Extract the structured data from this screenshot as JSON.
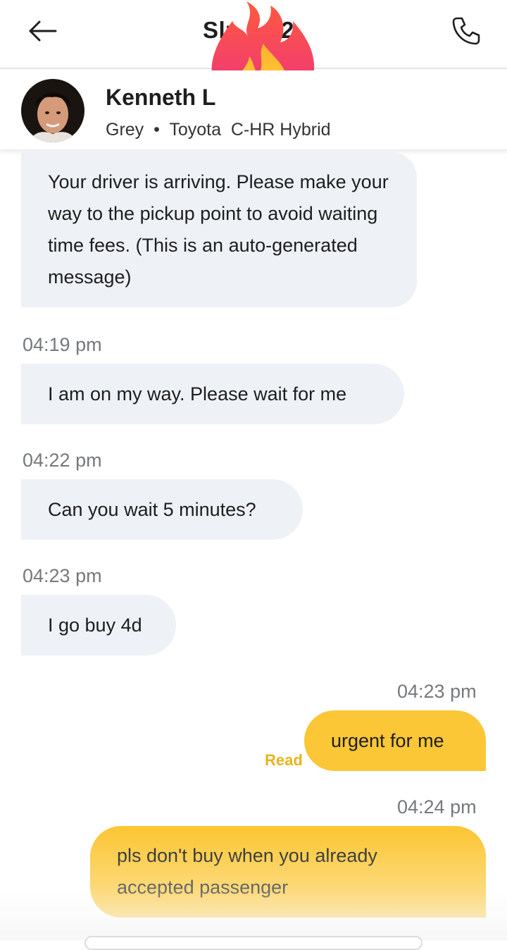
{
  "header": {
    "plate_visible": "Slz",
    "plate_tail": "2",
    "back_icon": "arrow-left-icon",
    "call_icon": "phone-icon",
    "sticker": "fire-emoji"
  },
  "driver": {
    "name": "Kenneth L",
    "color": "Grey",
    "separator": "•",
    "model": "Toyota  C-HR Hybrid"
  },
  "messages": [
    {
      "side": "in",
      "time": "",
      "text": "Your driver is arriving. Please make your way to the pickup point to avoid waiting time fees. (This is an auto-generated message)"
    },
    {
      "side": "in",
      "time": "04:19 pm",
      "text": "I am on my way. Please wait for me"
    },
    {
      "side": "in",
      "time": "04:22 pm",
      "text": "Can you wait 5 minutes?"
    },
    {
      "side": "in",
      "time": "04:23 pm",
      "text": "I go buy 4d"
    },
    {
      "side": "out",
      "time": "04:23 pm",
      "text": "urgent for me",
      "status": "Read"
    },
    {
      "side": "out",
      "time": "04:24 pm",
      "text": "pls don't buy when you already accepted passenger"
    }
  ],
  "colors": {
    "outgoing_bubble": "#fbc737",
    "incoming_bubble": "#eef1f5",
    "read_status": "#e7b41a",
    "timestamp": "#75797d"
  }
}
